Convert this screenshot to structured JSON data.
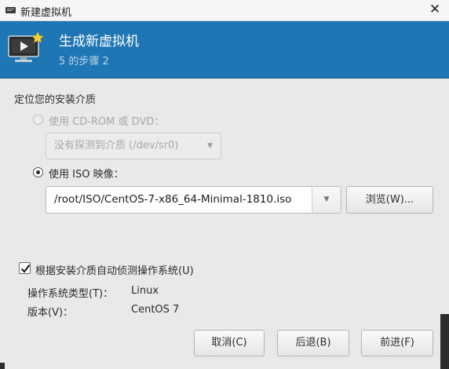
{
  "window": {
    "title": "新建虚拟机",
    "close_glyph": "✕"
  },
  "header": {
    "title": "生成新虚拟机",
    "step": "5 的步骤 2",
    "icon": "vm-monitor-icon",
    "bg_color": "#1f76b5"
  },
  "media": {
    "section_label": "定位您的安装介质",
    "cdrom": {
      "label": "使用 CD-ROM 或 DVD：",
      "selected": false,
      "enabled": false,
      "combo_value": "没有探测到介质 (/dev/sr0)"
    },
    "iso": {
      "label": "使用 ISO 映像：",
      "selected": true,
      "path": "/root/ISO/CentOS-7-x86_64-Minimal-1810.iso",
      "browse_label": "浏览(W)..."
    }
  },
  "detect": {
    "checked": true,
    "label": "根据安装介质自动侦测操作系统(U)",
    "os_type_label": "操作系统类型(T)：",
    "os_type_value": "Linux",
    "version_label": "版本(V)：",
    "version_value": "CentOS 7"
  },
  "buttons": {
    "cancel": "取消(C)",
    "back": "后退(B)",
    "forward": "前进(F)"
  }
}
